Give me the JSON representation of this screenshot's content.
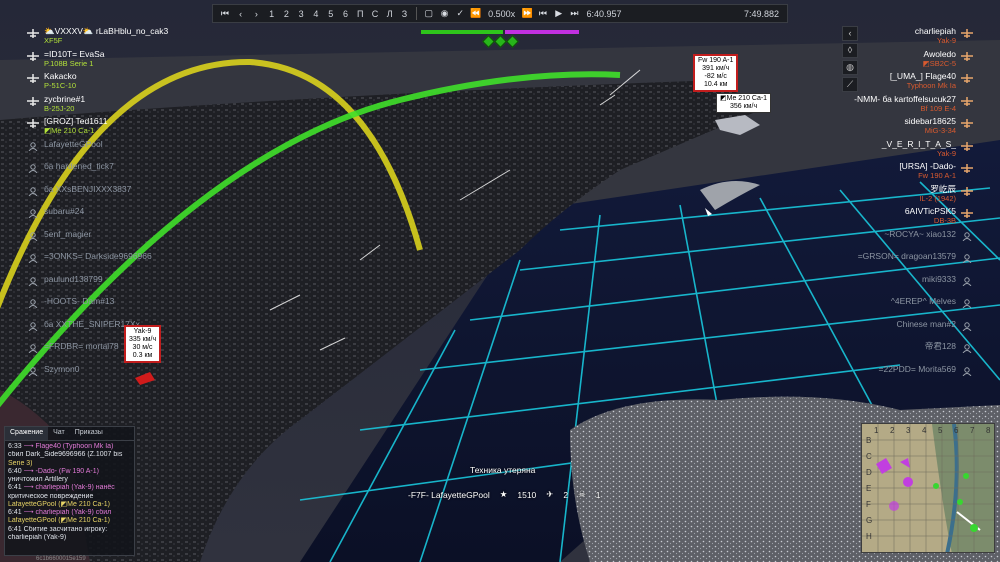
{
  "topbar": {
    "buttons": [
      "⏮",
      "‹",
      "›",
      "1",
      "2",
      "3",
      "4",
      "5",
      "6",
      "П",
      "С",
      "Л",
      "З"
    ],
    "speed": "0.500x",
    "time_current": "6:40.957",
    "time_total": "7:49.882",
    "progress": 0.85
  },
  "score": {
    "allies_fraction": 0.52,
    "enemy_fraction": 0.47
  },
  "team_left": [
    {
      "name": "⛅VXXXV⛅ rLaBHblu_no_cak3",
      "plane": "XF5F",
      "alive": true
    },
    {
      "name": "=ID10T= EvaSa",
      "plane": "P.108B Serie 1",
      "alive": true
    },
    {
      "name": "Kakacko",
      "plane": "P-51C-10",
      "alive": true
    },
    {
      "name": "zycbrine#1",
      "plane": "B-25J-20",
      "alive": true
    },
    {
      "name": "[GROZ] Ted1611",
      "plane": "◩Me 210 Ca-1",
      "alive": true
    },
    {
      "name": "LafayetteGPool",
      "plane": "",
      "alive": false
    },
    {
      "name": "ба hardened_tick7",
      "plane": "",
      "alive": false
    },
    {
      "name": "ба XXsBENJIXXX3837",
      "plane": "",
      "alive": false
    },
    {
      "name": "subaru#24",
      "plane": "",
      "alive": false
    },
    {
      "name": "5enf_magier",
      "plane": "",
      "alive": false
    },
    {
      "name": "=3ONKS= Darkside9696966",
      "plane": "",
      "alive": false
    },
    {
      "name": "paulund138799",
      "plane": "",
      "alive": false
    },
    {
      "name": "-HOOTS- Dam#13",
      "plane": "",
      "alive": false
    },
    {
      "name": "ба XXTHE_SNIPER17Xx",
      "plane": "",
      "alive": false
    },
    {
      "name": "=FRDBR= mortal78",
      "plane": "",
      "alive": false
    },
    {
      "name": "Szymon0",
      "plane": "",
      "alive": false
    }
  ],
  "team_right": [
    {
      "name": "charliepiah",
      "plane": "Yak-9",
      "alive": true
    },
    {
      "name": "Awoledo",
      "plane": "◩SB2C-5",
      "alive": true
    },
    {
      "name": "[_UMA_] Flage40",
      "plane": "Typhoon Mk Ia",
      "alive": true
    },
    {
      "name": "-NMM- ба kartoffelsucuk27",
      "plane": "Bf 109 E-4",
      "alive": true
    },
    {
      "name": "sidebar18625",
      "plane": "MiG-3-34",
      "alive": true
    },
    {
      "name": "_V_E_R_I_T_A_S_",
      "plane": "Yak-9",
      "alive": true
    },
    {
      "name": "[URSA] -Dado-",
      "plane": "Fw 190 A-1",
      "alive": true
    },
    {
      "name": "罗屹辰",
      "plane": "IL-2 (1942)",
      "alive": true
    },
    {
      "name": "6AIVTicPSK5",
      "plane": "DB-3B",
      "alive": true
    },
    {
      "name": "~ROCYA~ xiao132",
      "plane": "",
      "alive": false
    },
    {
      "name": "=GRSON= dragoan13579",
      "plane": "",
      "alive": false
    },
    {
      "name": "miki9333",
      "plane": "",
      "alive": false
    },
    {
      "name": "^4EREP^ Melves",
      "plane": "",
      "alive": false
    },
    {
      "name": "Chinese man#2",
      "plane": "",
      "alive": false
    },
    {
      "name": "帝君128",
      "plane": "",
      "alive": false
    },
    {
      "name": "=22PDD= Morita569",
      "plane": "",
      "alive": false
    }
  ],
  "markers": {
    "fw190": [
      "Fw 190 A-1",
      "391 км/ч",
      "-82 м/с",
      "10.4 км"
    ],
    "me210": [
      "◩Me 210 Ca-1",
      "356 км/ч"
    ],
    "yak9": [
      "Yak-9",
      "335 км/ч",
      "30 м/с",
      "0.3 км"
    ]
  },
  "center_message": "Техника утеряна",
  "kill_row": {
    "player": "-F7F- LafayetteGPool",
    "score": "1510",
    "kills": "2",
    "deaths": "1"
  },
  "chat": {
    "tabs": [
      "Сражение",
      "Чат",
      "Приказы"
    ],
    "lines": [
      {
        "t": "6:33",
        "text": "⟶ Flage40 (Typhoon Mk Ia)",
        "c": "c-m"
      },
      {
        "t": "",
        "text": "сбил Dark_Side9696966 (Z.1007 bis",
        "c": "c-w"
      },
      {
        "t": "",
        "text": "Serie 3)",
        "c": "c-y"
      },
      {
        "t": "6:40",
        "text": "⟶ -Dado- (Fw 190 A-1)",
        "c": "c-m"
      },
      {
        "t": "",
        "text": "уничтожил Artillery",
        "c": "c-w"
      },
      {
        "t": "6:41",
        "text": "⟶ charliepiah (Yak-9) нанёс",
        "c": "c-m"
      },
      {
        "t": "",
        "text": "критическое повреждение",
        "c": "c-w"
      },
      {
        "t": "",
        "text": "LafayetteGPool (◩Me 210 Ca-1)",
        "c": "c-y"
      },
      {
        "t": "6:41",
        "text": "⟶ charliepiah (Yak-9) сбил",
        "c": "c-m"
      },
      {
        "t": "",
        "text": "LafayetteGPool (◩Me 210 Ca-1)",
        "c": "c-y"
      },
      {
        "t": "6:41",
        "text": "Сбитие засчитано игроку:",
        "c": "c-w"
      },
      {
        "t": "",
        "text": "charliepiah (Yak-9)",
        "c": "c-w"
      }
    ]
  },
  "minimap": {
    "cols": [
      "1",
      "2",
      "3",
      "4",
      "5",
      "6",
      "7",
      "8"
    ],
    "rows": [
      "B",
      "C",
      "D",
      "E",
      "F",
      "G",
      "H"
    ]
  },
  "footer_id": "6c1b6600015e159",
  "colors": {
    "ally": "#2ec41b",
    "enemy": "#c130e0",
    "grid": "#18c4d8",
    "tag_border": "#c21d1d"
  }
}
